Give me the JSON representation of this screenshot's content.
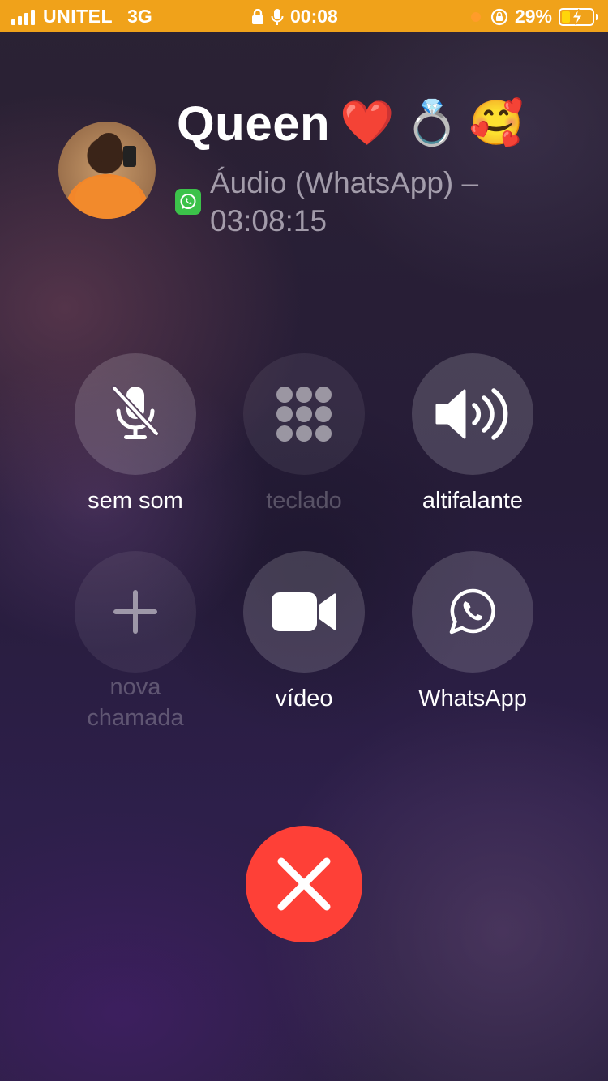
{
  "status_bar": {
    "carrier": "UNITEL",
    "network": "3G",
    "time": "00:08",
    "battery_percent": "29%",
    "battery_level": 0.29,
    "accent_color": "#f0a21a"
  },
  "call": {
    "contact_name": "Queen",
    "name_emojis": [
      "❤️",
      "💍",
      "🥰"
    ],
    "subtitle_line1": "Áudio (WhatsApp) –",
    "subtitle_line2": "03:08:15",
    "app_icon": "whatsapp-icon"
  },
  "controls": {
    "mute": {
      "label": "sem som",
      "icon": "mic-off-icon"
    },
    "keypad": {
      "label": "teclado",
      "icon": "keypad-icon"
    },
    "speaker": {
      "label": "altifalante",
      "icon": "speaker-icon"
    },
    "add_call": {
      "label_line1": "nova",
      "label_line2": "chamada",
      "icon": "plus-icon"
    },
    "video": {
      "label": "vídeo",
      "icon": "video-camera-icon"
    },
    "whatsapp": {
      "label": "WhatsApp",
      "icon": "whatsapp-icon"
    },
    "end_call": {
      "icon": "close-icon",
      "color": "#fe4037"
    }
  }
}
